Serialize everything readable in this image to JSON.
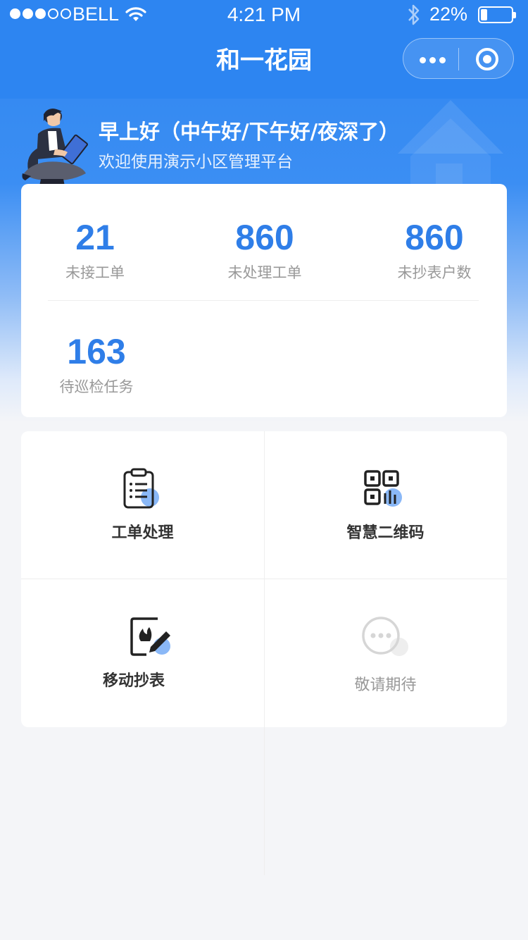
{
  "status_bar": {
    "carrier": "BELL",
    "time": "4:21 PM",
    "battery_percent": "22%",
    "battery_level": 0.22,
    "signal_bars_filled": 3,
    "signal_bars_total": 5
  },
  "nav": {
    "title": "和一花园"
  },
  "hero": {
    "greeting": "早上好（中午好/下午好/夜深了）",
    "welcome": "欢迎使用演示小区管理平台"
  },
  "stats": [
    {
      "value": "21",
      "label": "未接工单"
    },
    {
      "value": "860",
      "label": "未处理工单"
    },
    {
      "value": "860",
      "label": "未抄表户数"
    },
    {
      "value": "163",
      "label": "待巡检任务"
    }
  ],
  "menu": [
    {
      "label": "工单处理",
      "icon": "clipboard-icon"
    },
    {
      "label": "智慧二维码",
      "icon": "qr-code-icon"
    },
    {
      "label": "移动抄表",
      "icon": "edit-meter-icon"
    },
    {
      "label": "敬请期待",
      "icon": "more-dots-icon"
    }
  ],
  "colors": {
    "primary": "#2d85f1",
    "stat_value": "#2f7ee8",
    "icon_accent": "#8ab8f7"
  }
}
